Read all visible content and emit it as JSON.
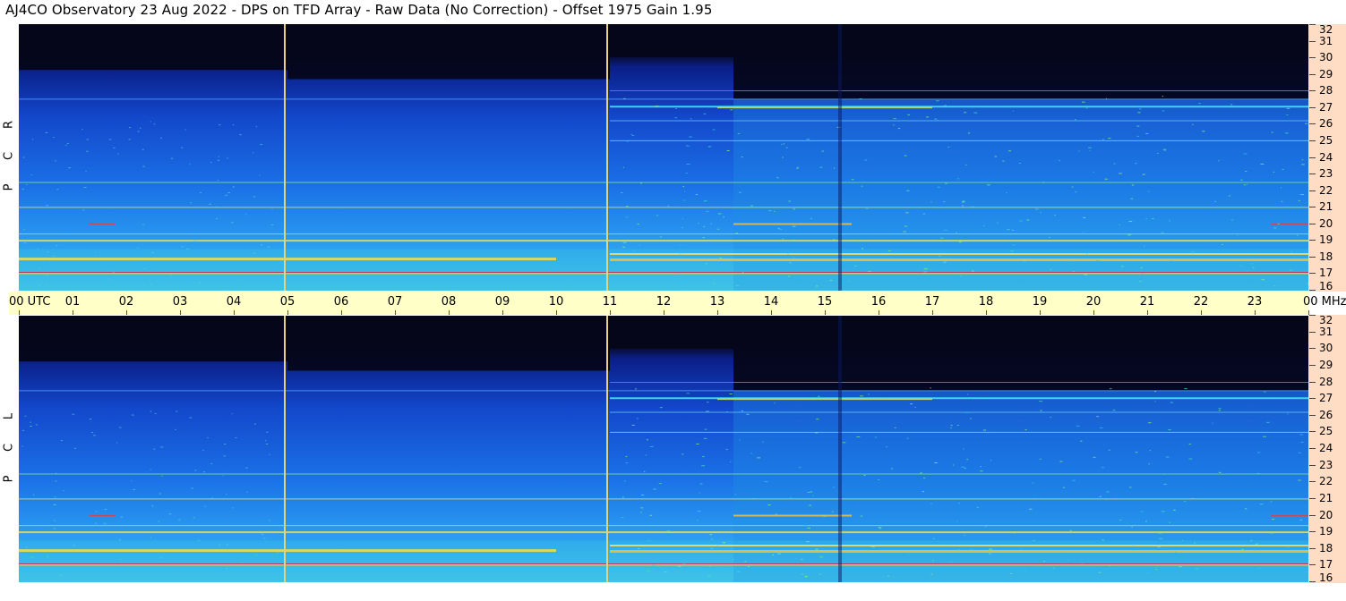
{
  "title": "AJ4CO Observatory  23 Aug 2022  -  DPS on TFD Array  -  Raw Data (No Correction)  -  Offset 1975  Gain 1.95",
  "panels": [
    {
      "label_chars": [
        "R",
        "C",
        "P"
      ]
    },
    {
      "label_chars": [
        "L",
        "C",
        "P"
      ]
    }
  ],
  "time_axis": {
    "labels": [
      "00  UTC",
      "01",
      "02",
      "03",
      "04",
      "05",
      "06",
      "07",
      "08",
      "09",
      "10",
      "11",
      "12",
      "13",
      "14",
      "15",
      "16",
      "17",
      "18",
      "19",
      "20",
      "21",
      "22",
      "23",
      "00 MHz"
    ]
  },
  "freq_axis": {
    "labels": [
      "32",
      "31",
      "30",
      "29",
      "28",
      "27",
      "26",
      "25",
      "24",
      "23",
      "22",
      "21",
      "20",
      "19",
      "18",
      "17",
      "16"
    ]
  },
  "chart_data": {
    "type": "heatmap",
    "title": "AJ4CO Observatory  23 Aug 2022  -  DPS on TFD Array  -  Raw Data (No Correction)  -  Offset 1975  Gain 1.95",
    "x_ticks": [
      "00",
      "01",
      "02",
      "03",
      "04",
      "05",
      "06",
      "07",
      "08",
      "09",
      "10",
      "11",
      "12",
      "13",
      "14",
      "15",
      "16",
      "17",
      "18",
      "19",
      "20",
      "21",
      "22",
      "23",
      "00"
    ],
    "xlabel": "UTC",
    "y_ticks": [
      32,
      31,
      30,
      29,
      28,
      27,
      26,
      25,
      24,
      23,
      22,
      21,
      20,
      19,
      18,
      17,
      16
    ],
    "ylabel": "MHz",
    "xlim": [
      0,
      24
    ],
    "ylim": [
      16,
      32
    ],
    "series": [
      {
        "name": "RCP"
      },
      {
        "name": "LCP"
      }
    ],
    "vertical_markers_utc": [
      4.95,
      10.95
    ],
    "band_edge_mhz": {
      "before_13utc": 29.8,
      "after_13utc": 27.5
    }
  }
}
